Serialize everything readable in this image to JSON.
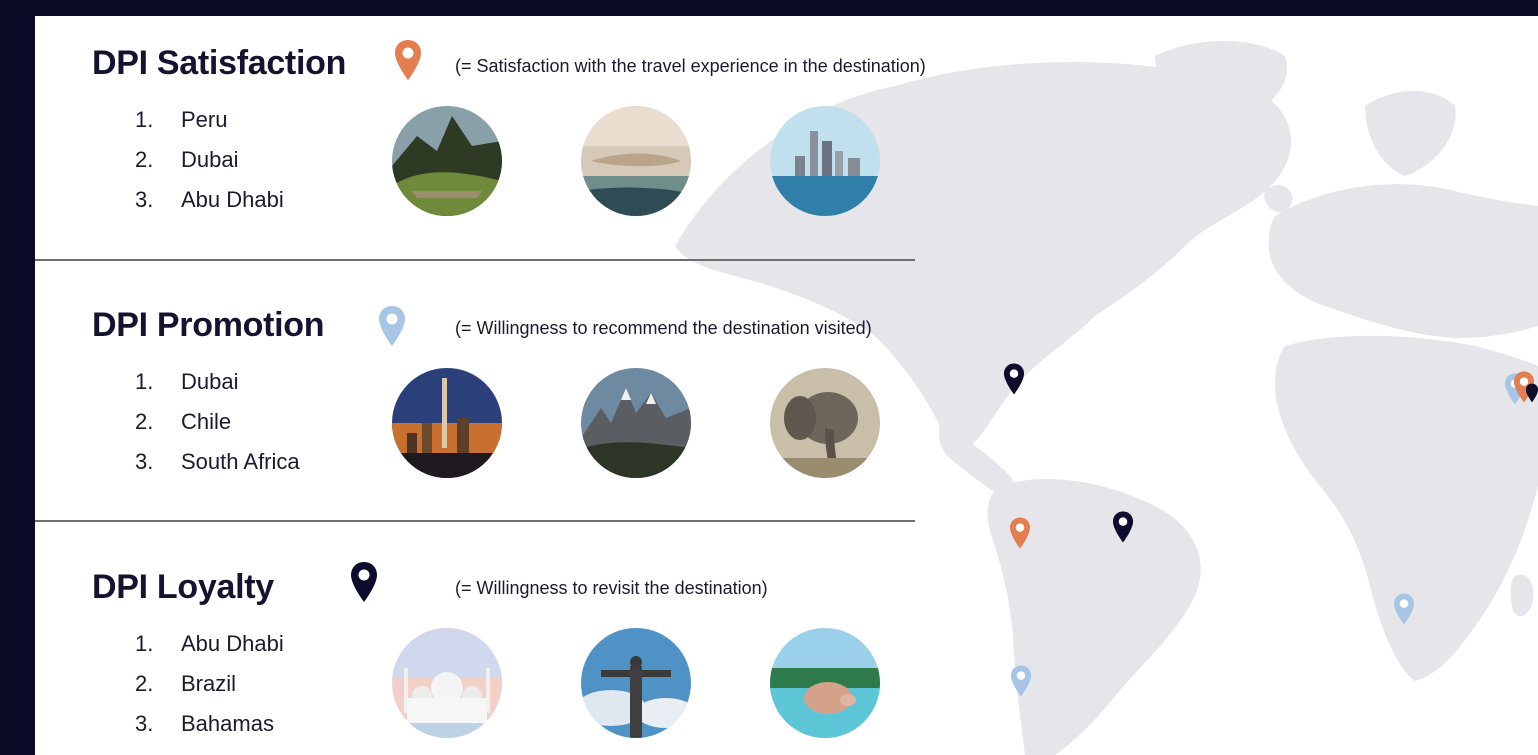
{
  "colors": {
    "background": "#0b0b26",
    "satisfaction_pin": "#e47d50",
    "promotion_pin": "#a7c5e4",
    "loyalty_pin": "#0e0d2d",
    "map_land": "#e6e6ea"
  },
  "sections": [
    {
      "title": "DPI Satisfaction",
      "pin_icon": "map-pin-orange",
      "subtitle": "(= Satisfaction with the travel experience in the destination)",
      "items": [
        {
          "num": "1.",
          "name": "Peru"
        },
        {
          "num": "2.",
          "name": "Dubai"
        },
        {
          "num": "3.",
          "name": "Abu Dhabi"
        }
      ],
      "photos": [
        "machu-picchu-photo",
        "palm-jumeirah-photo",
        "abu-dhabi-skyline-photo"
      ]
    },
    {
      "title": "DPI Promotion",
      "pin_icon": "map-pin-light-blue",
      "subtitle": "(= Willingness to recommend the destination visited)",
      "items": [
        {
          "num": "1.",
          "name": "Dubai"
        },
        {
          "num": "2.",
          "name": "Chile"
        },
        {
          "num": "3.",
          "name": "South Africa"
        }
      ],
      "photos": [
        "dubai-night-skyline-photo",
        "patagonia-mountains-photo",
        "elephant-photo"
      ]
    },
    {
      "title": "DPI Loyalty",
      "pin_icon": "map-pin-navy",
      "subtitle": "(= Willingness to revisit the destination)",
      "items": [
        {
          "num": "1.",
          "name": "Abu Dhabi"
        },
        {
          "num": "2.",
          "name": "Brazil"
        },
        {
          "num": "3.",
          "name": "Bahamas"
        }
      ],
      "photos": [
        "sheikh-zayed-mosque-photo",
        "christ-the-redeemer-photo",
        "swimming-pig-photo"
      ]
    }
  ],
  "map_pins": [
    {
      "marks": "Bahamas",
      "category": "loyalty"
    },
    {
      "marks": "Peru",
      "category": "satisfaction"
    },
    {
      "marks": "Brazil",
      "category": "loyalty"
    },
    {
      "marks": "Chile",
      "category": "promotion"
    },
    {
      "marks": "South Africa",
      "category": "promotion"
    },
    {
      "marks": "Dubai",
      "category": "promotion"
    },
    {
      "marks": "Dubai",
      "category": "satisfaction"
    },
    {
      "marks": "Abu Dhabi",
      "category": "loyalty"
    }
  ]
}
